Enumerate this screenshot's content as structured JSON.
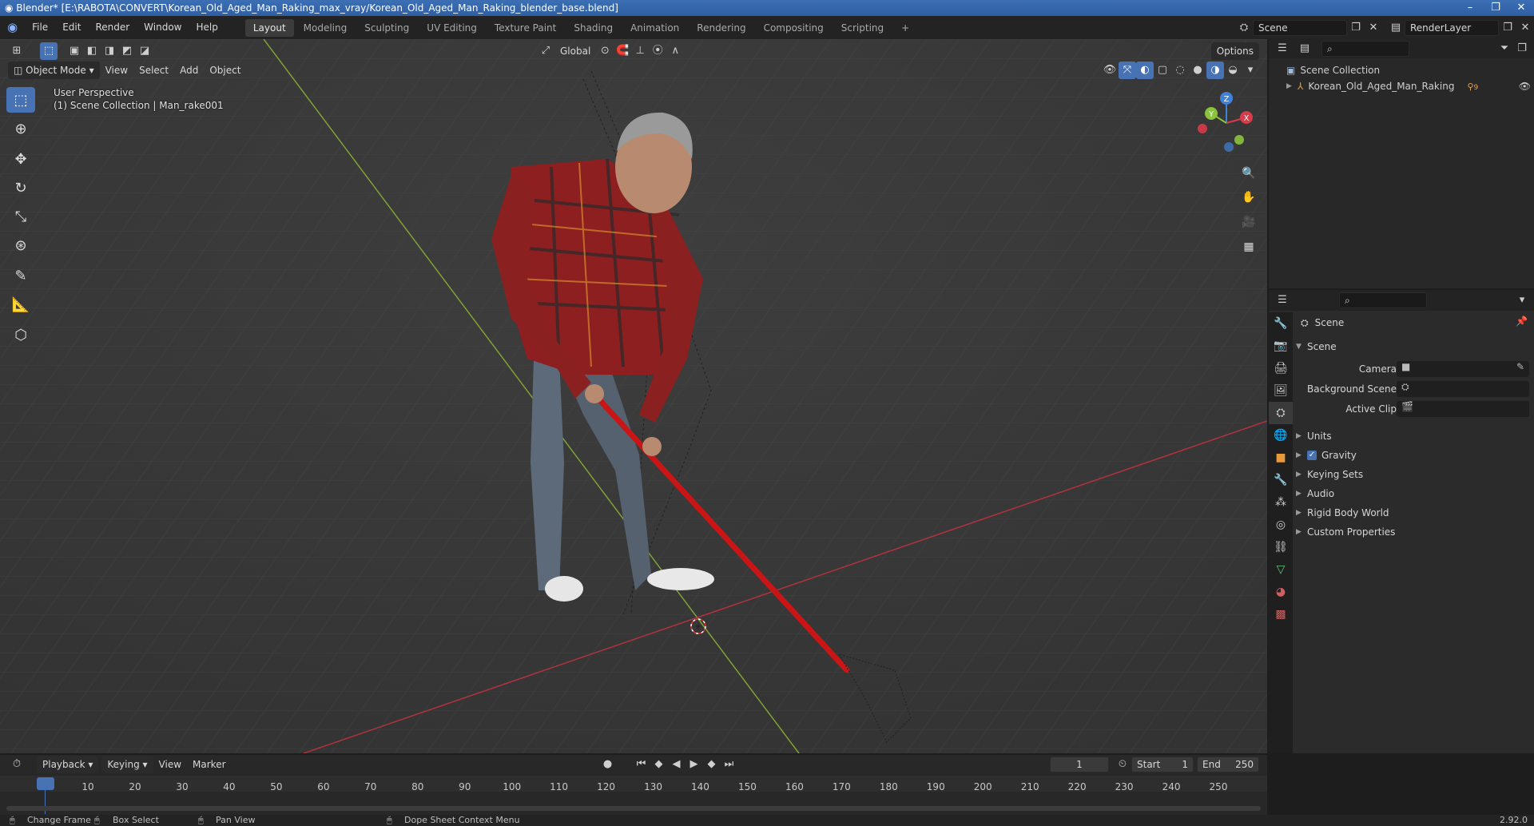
{
  "window": {
    "title": "Blender* [E:\\RABOTA\\CONVERT\\Korean_Old_Aged_Man_Raking_max_vray/Korean_Old_Aged_Man_Raking_blender_base.blend]",
    "minimize": "–",
    "maximize": "❐",
    "close": "✕"
  },
  "menu": {
    "items": [
      "File",
      "Edit",
      "Render",
      "Window",
      "Help"
    ]
  },
  "workspaces": {
    "tabs": [
      "Layout",
      "Modeling",
      "Sculpting",
      "UV Editing",
      "Texture Paint",
      "Shading",
      "Animation",
      "Rendering",
      "Compositing",
      "Scripting"
    ],
    "active": "Layout",
    "add": "+"
  },
  "scene_selector": {
    "value": "Scene"
  },
  "view_layer": {
    "value": "RenderLayer"
  },
  "viewport": {
    "mode": "Object Mode",
    "menus": [
      "View",
      "Select",
      "Add",
      "Object"
    ],
    "transform_orientation": "Global",
    "options_label": "Options",
    "perspective_label": "User Perspective",
    "collection_label": "(1) Scene Collection | Man_rake001",
    "gizmo_axes": {
      "x": "X",
      "y": "Y",
      "z": "Z"
    }
  },
  "outliner": {
    "root": "Scene Collection",
    "items": [
      {
        "label": "Korean_Old_Aged_Man_Raking",
        "badge": "9"
      }
    ]
  },
  "properties": {
    "header": "Scene",
    "panel": "Scene",
    "fields": [
      {
        "label": "Camera",
        "value": ""
      },
      {
        "label": "Background Scene",
        "value": ""
      },
      {
        "label": "Active Clip",
        "value": ""
      }
    ],
    "sections": [
      "Units",
      "Gravity",
      "Keying Sets",
      "Audio",
      "Rigid Body World",
      "Custom Properties"
    ],
    "gravity_checked": true
  },
  "timeline": {
    "menus": [
      "Playback",
      "Keying",
      "View",
      "Marker"
    ],
    "current_frame": "1",
    "start_label": "Start",
    "start_value": "1",
    "end_label": "End",
    "end_value": "250",
    "ticks": [
      "1",
      "10",
      "20",
      "30",
      "40",
      "50",
      "60",
      "70",
      "80",
      "90",
      "100",
      "110",
      "120",
      "130",
      "140",
      "150",
      "160",
      "170",
      "180",
      "190",
      "200",
      "210",
      "220",
      "230",
      "240",
      "250"
    ]
  },
  "status_bar": {
    "items": [
      "Change Frame",
      "Box Select",
      "Pan View",
      "Dope Sheet Context Menu"
    ],
    "version": "2.92.0"
  },
  "colors": {
    "accent": "#4772b3",
    "x_axis": "#d93b4b",
    "y_axis": "#8ac33c",
    "z_axis": "#3f82d8",
    "rake": "#c91515"
  }
}
